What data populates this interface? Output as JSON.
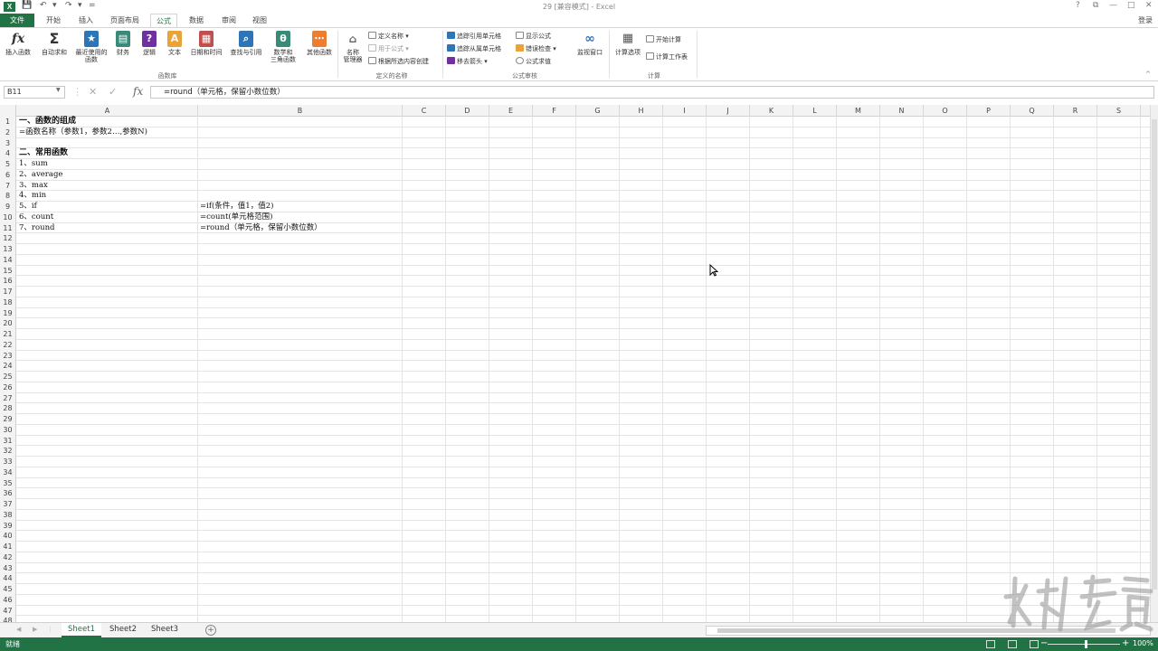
{
  "titlebar": {
    "title": "29 [兼容模式] - Excel",
    "save_icon": "save-icon",
    "undo_icon": "undo-icon",
    "redo_icon": "redo-icon",
    "help": "?",
    "restore": "⧉",
    "minimize": "—",
    "maximize": "□",
    "close": "✕"
  },
  "tabs": [
    {
      "label": "文件"
    },
    {
      "label": "开始"
    },
    {
      "label": "插入"
    },
    {
      "label": "页面布局"
    },
    {
      "label": "公式"
    },
    {
      "label": "数据"
    },
    {
      "label": "审阅"
    },
    {
      "label": "视图"
    }
  ],
  "login": "登录",
  "ribbon": {
    "insert_function": "插入函数",
    "autosum": "自动求和",
    "recent": [
      "最近使用的",
      "函数"
    ],
    "finance": "财务",
    "logic": "逻辑",
    "text": "文本",
    "datetime": "日期和时间",
    "lookup": "查找与引用",
    "math": [
      "数学和",
      "三角函数"
    ],
    "other": "其他函数",
    "group_library": "函数库",
    "name_manager": [
      "名称",
      "管理器"
    ],
    "define_name": "定义名称",
    "use_in_formula": "用于公式",
    "create_from_selection": "根据所选内容创建",
    "group_names": "定义的名称",
    "trace_precedents": "追踪引用单元格",
    "trace_dependents": "追踪从属单元格",
    "remove_arrows": "移去箭头",
    "show_formulas": "显示公式",
    "error_check": "错误检查",
    "evaluate": "公式求值",
    "watch_window": "监视窗口",
    "group_audit": "公式审核",
    "calc_options": "计算选项",
    "calc_now": "开始计算",
    "calc_sheet": "计算工作表",
    "group_calc": "计算",
    "colors": {
      "blue": "#2e75b6",
      "purple": "#7030a0",
      "orange": "#ed7d31",
      "green": "#217346",
      "teal": "#3a8a7a",
      "red": "#c0504d",
      "gold": "#e8a33a"
    }
  },
  "formula_bar": {
    "name_box": "B11",
    "cancel": "✕",
    "enter": "✓",
    "fx": "fx",
    "formula": "=round（单元格，保留小数位数）"
  },
  "grid": {
    "columns": [
      "A",
      "B",
      "C",
      "D",
      "E",
      "F",
      "G",
      "H",
      "I",
      "J",
      "K",
      "L",
      "M",
      "N",
      "O",
      "P",
      "Q",
      "R",
      "S"
    ],
    "rows": [
      "1",
      "2",
      "3",
      "4",
      "5",
      "6",
      "7",
      "8",
      "9",
      "10",
      "11",
      "12",
      "13",
      "14",
      "15",
      "16",
      "17",
      "18",
      "19",
      "20",
      "21",
      "22",
      "23",
      "24",
      "25",
      "26",
      "27",
      "28",
      "29",
      "30",
      "31",
      "32",
      "33",
      "34",
      "35",
      "36",
      "37",
      "38",
      "39",
      "40",
      "41",
      "42",
      "43",
      "44",
      "45",
      "46",
      "47",
      "48"
    ],
    "cells": {
      "A1": "一、函数的组成",
      "A2": " =函数名称（参数1，参数2…,参数N)",
      "A4": "二、常用函数",
      "A5": "1、sum",
      "A6": "2、average",
      "A7": "3、max",
      "A8": "4、min",
      "A9": "5、if",
      "A10": "6、count",
      "A11": "7、round",
      "B9": "=if(条件，值1，值2)",
      "B10": "=count(单元格范围)",
      "B11": "=round（单元格，保留小数位数）"
    }
  },
  "sheets": [
    {
      "label": "Sheet1"
    },
    {
      "label": "Sheet2"
    },
    {
      "label": "Sheet3"
    }
  ],
  "add_sheet": "+",
  "status": {
    "ready": "就绪",
    "zoom": "100%",
    "zoom_minus": "−",
    "zoom_plus": "+"
  }
}
